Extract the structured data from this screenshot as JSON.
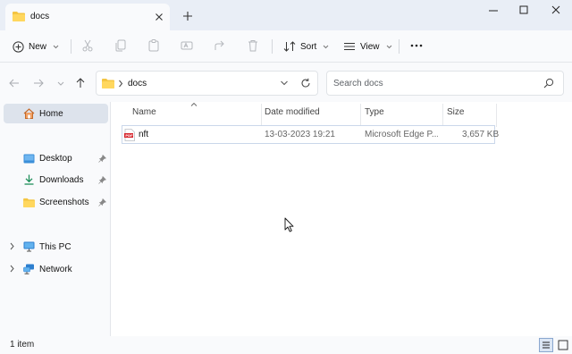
{
  "tabs": [
    {
      "title": "docs",
      "icon": "folder-icon"
    }
  ],
  "window_controls": [
    "minimize-icon",
    "maximize-icon",
    "close-icon"
  ],
  "toolbar": {
    "new_label": "New",
    "sort_label": "Sort",
    "view_label": "View",
    "icons": [
      "cut-icon",
      "copy-icon",
      "paste-icon",
      "rename-icon",
      "share-icon",
      "delete-icon",
      "more-icon"
    ]
  },
  "address": {
    "path": "docs",
    "search_placeholder": "Search docs"
  },
  "sidebar": {
    "home": "Home",
    "quick_access": [
      {
        "label": "Desktop",
        "icon": "desktop-icon",
        "pinned": true
      },
      {
        "label": "Downloads",
        "icon": "downloads-icon",
        "pinned": true
      },
      {
        "label": "Screenshots",
        "icon": "folder-icon",
        "pinned": true
      }
    ],
    "this_pc": "This PC",
    "network": "Network"
  },
  "columns": {
    "name": "Name",
    "date": "Date modified",
    "type": "Type",
    "size": "Size"
  },
  "files": [
    {
      "name": "nft",
      "date": "13-03-2023 19:21",
      "type": "Microsoft Edge P...",
      "size": "3,657 KB",
      "icon": "pdf-file-icon"
    }
  ],
  "status": {
    "item_count": "1 item"
  },
  "colors": {
    "accent": "#0067c0",
    "folder": "#f4c542",
    "pdf": "#d6252d",
    "selection_border": "#cad7ea"
  }
}
